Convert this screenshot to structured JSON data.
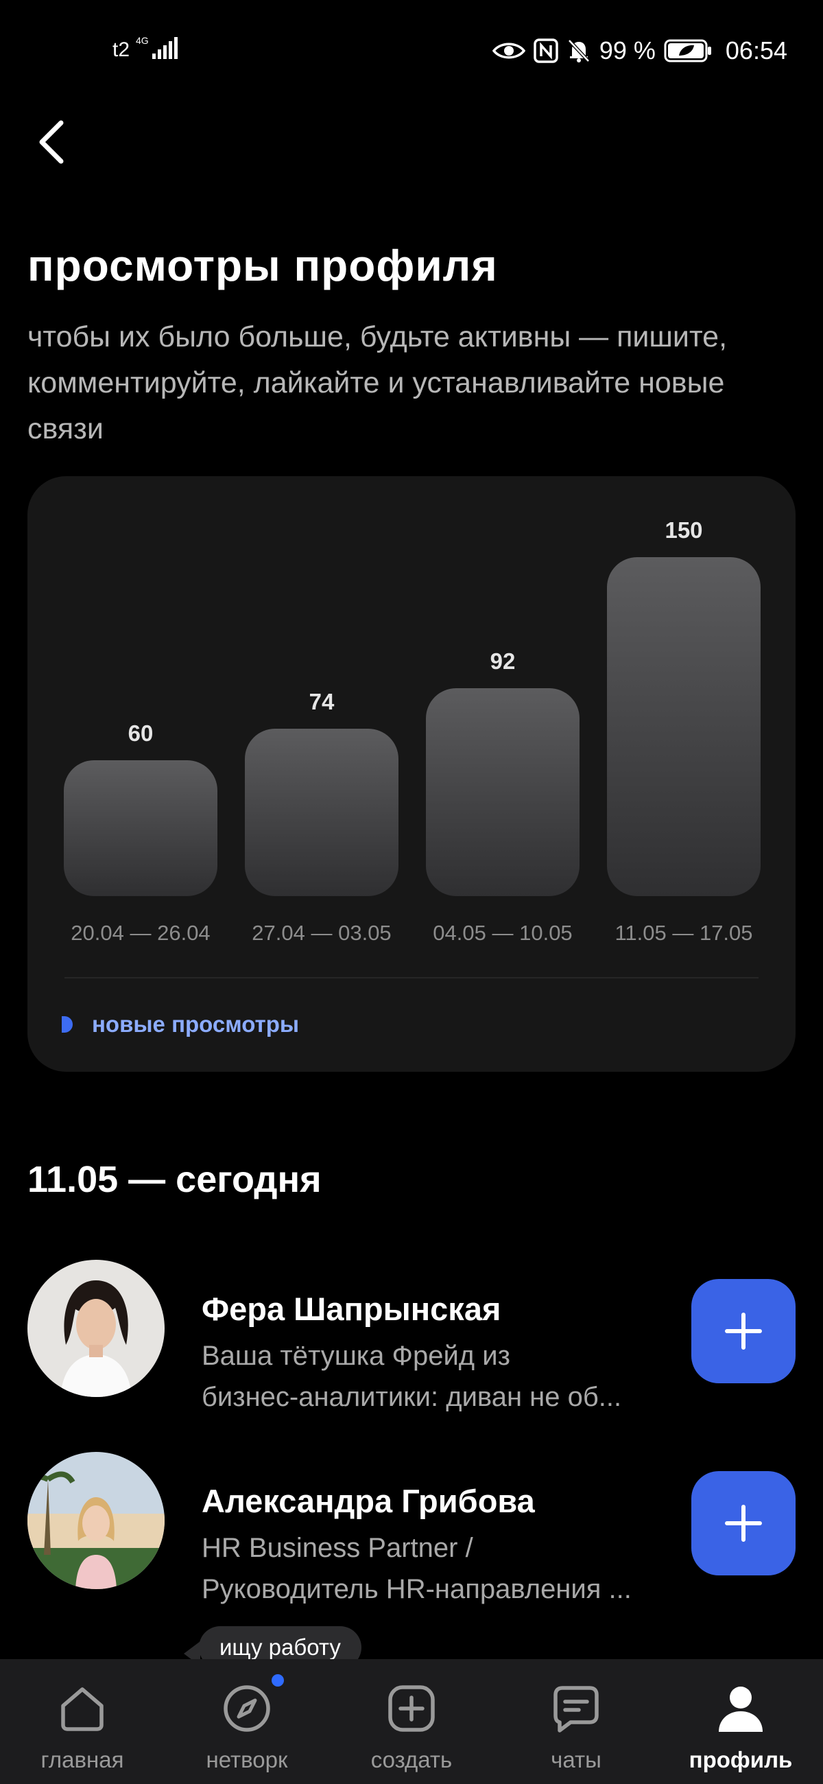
{
  "status_bar": {
    "carrier": "t2",
    "network": "4G",
    "battery": "99 %",
    "time": "06:54"
  },
  "header": {
    "title": "просмотры профиля",
    "subtitle": "чтобы их было больше, будьте активны — пишите, комментируйте, лайкайте и устанавливайте новые связи"
  },
  "chart_data": {
    "type": "bar",
    "categories": [
      "20.04 — 26.04",
      "27.04 — 03.05",
      "04.05 — 10.05",
      "11.05 — 17.05"
    ],
    "values": [
      60,
      74,
      92,
      150
    ],
    "series": [
      {
        "name": "новые просмотры",
        "values": [
          60,
          74,
          92,
          150
        ]
      }
    ],
    "legend": "bottom-left",
    "grid": false,
    "accent_color": "#3d6cf2"
  },
  "section": {
    "title": "11.05 — сегодня"
  },
  "people": [
    {
      "name": "Фера Шапрынская",
      "desc_line1": "Ваша тётушка Фрейд из",
      "desc_line2": "бизнес-аналитики: диван не об..."
    },
    {
      "name": "Александра Грибова",
      "desc_line1": "HR Business Partner /",
      "desc_line2": "Руководитель HR-направления ..."
    }
  ],
  "tag": "ищу работу",
  "bottom_nav": [
    {
      "label": "главная",
      "icon": "home-icon"
    },
    {
      "label": "нетворк",
      "icon": "compass-icon"
    },
    {
      "label": "создать",
      "icon": "plus-square-icon"
    },
    {
      "label": "чаты",
      "icon": "chat-icon"
    },
    {
      "label": "профиль",
      "icon": "profile-icon"
    }
  ],
  "colors": {
    "accent": "#3a63e6",
    "legend_text": "#8cacff",
    "background": "#000000",
    "card": "#171717"
  }
}
